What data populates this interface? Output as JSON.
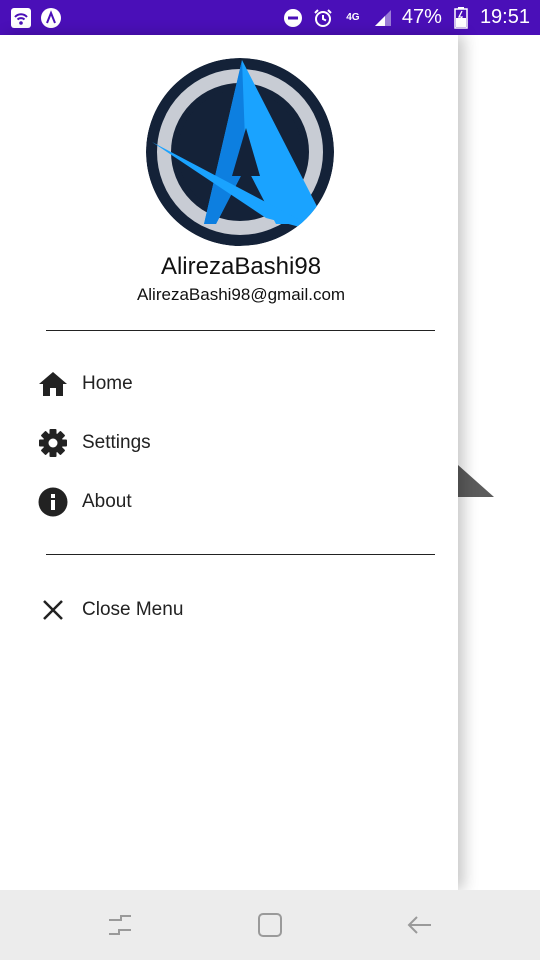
{
  "status_bar": {
    "network_type": "4G",
    "battery": "47%",
    "time": "19:51",
    "icons": [
      "wifi-hotspot-icon",
      "app-notification-icon",
      "do-not-disturb-icon",
      "alarm-icon",
      "signal-icon",
      "battery-icon"
    ]
  },
  "drawer": {
    "profile": {
      "name": "AlirezaBashi98",
      "email": "AlirezaBashi98@gmail.com"
    },
    "menu": [
      {
        "label": "Home",
        "icon": "home-icon"
      },
      {
        "label": "Settings",
        "icon": "gear-icon"
      },
      {
        "label": "About",
        "icon": "info-icon"
      }
    ],
    "close": {
      "label": "Close Menu",
      "icon": "close-icon"
    }
  },
  "nav_bar": {
    "buttons": [
      "recent-apps-icon",
      "home-button-icon",
      "back-icon"
    ]
  },
  "colors": {
    "status_bar": "#4a0fb8",
    "logo_blue": "#1aa3ff",
    "logo_dark": "#142238"
  }
}
